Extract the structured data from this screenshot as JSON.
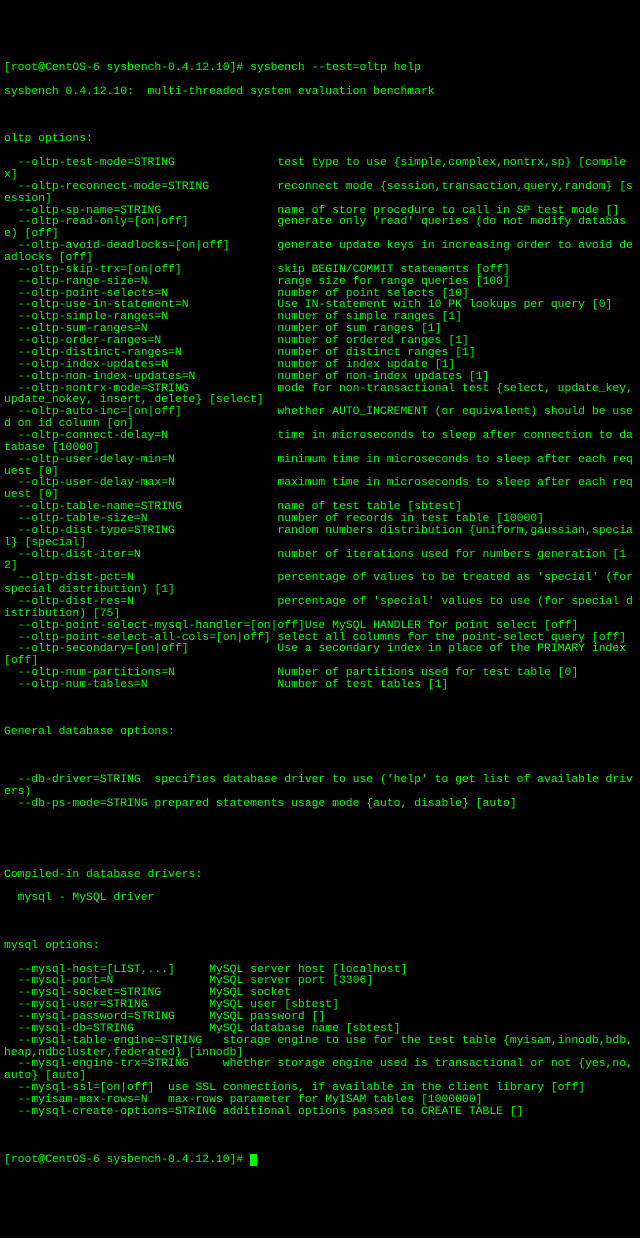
{
  "prompt": "[root@CentOS-6 sysbench-0.4.12.10]# ",
  "cmd": "sysbench --test=oltp help",
  "header": "sysbench 0.4.12.10:  multi-threaded system evaluation benchmark",
  "oltp_title": "oltp options:",
  "oltp_opts": [
    {
      "f": "  --oltp-test-mode=STRING",
      "d": "test type to use {simple,complex,nontrx,sp} [complex]"
    },
    {
      "f": "  --oltp-reconnect-mode=STRING",
      "d": "reconnect mode {session,transaction,query,random} [session]"
    },
    {
      "f": "  --oltp-sp-name=STRING",
      "d": "name of store procedure to call in SP test mode []"
    },
    {
      "f": "  --oltp-read-only=[on|off]",
      "d": "generate only 'read' queries (do not modify database) [off]"
    },
    {
      "f": "  --oltp-avoid-deadlocks=[on|off]",
      "d": "generate update keys in increasing order to avoid deadlocks [off]"
    },
    {
      "f": "  --oltp-skip-trx=[on|off]",
      "d": "skip BEGIN/COMMIT statements [off]"
    },
    {
      "f": "  --oltp-range-size=N",
      "d": "range size for range queries [100]"
    },
    {
      "f": "  --oltp-point-selects=N",
      "d": "number of point selects [10]"
    },
    {
      "f": "  --oltp-use-in-statement=N",
      "d": "Use IN-statement with 10 PK lookups per query [0]"
    },
    {
      "f": "  --oltp-simple-ranges=N",
      "d": "number of simple ranges [1]"
    },
    {
      "f": "  --oltp-sum-ranges=N",
      "d": "number of sum ranges [1]"
    },
    {
      "f": "  --oltp-order-ranges=N",
      "d": "number of ordered ranges [1]"
    },
    {
      "f": "  --oltp-distinct-ranges=N",
      "d": "number of distinct ranges [1]"
    },
    {
      "f": "  --oltp-index-updates=N",
      "d": "number of index update [1]"
    },
    {
      "f": "  --oltp-non-index-updates=N",
      "d": "number of non-index updates [1]"
    },
    {
      "f": "  --oltp-nontrx-mode=STRING",
      "d": "mode for non-transactional test {select, update_key, update_nokey, insert, delete} [select]"
    },
    {
      "f": "  --oltp-auto-inc=[on|off]",
      "d": "whether AUTO_INCREMENT (or equivalent) should be used on id column [on]"
    },
    {
      "f": "  --oltp-connect-delay=N",
      "d": "time in microseconds to sleep after connection to database [10000]"
    },
    {
      "f": "  --oltp-user-delay-min=N",
      "d": "minimum time in microseconds to sleep after each request [0]"
    },
    {
      "f": "  --oltp-user-delay-max=N",
      "d": "maximum time in microseconds to sleep after each request [0]"
    },
    {
      "f": "  --oltp-table-name=STRING",
      "d": "name of test table [sbtest]"
    },
    {
      "f": "  --oltp-table-size=N",
      "d": "number of records in test table [10000]"
    },
    {
      "f": "  --oltp-dist-type=STRING",
      "d": "random numbers distribution {uniform,gaussian,special} [special]"
    },
    {
      "f": "  --oltp-dist-iter=N",
      "d": "number of iterations used for numbers generation [12]"
    },
    {
      "f": "  --oltp-dist-pct=N",
      "d": "percentage of values to be treated as 'special' (for special distribution) [1]"
    },
    {
      "f": "  --oltp-dist-res=N",
      "d": "percentage of 'special' values to use (for special distribution) [75]"
    },
    {
      "f": "  --oltp-point-select-mysql-handler=[on|off]",
      "d": "Use MySQL HANDLER for point select [off]"
    },
    {
      "f": "  --oltp-point-select-all-cols=[on|off]",
      "d": "select all columns for the point-select query [off]"
    },
    {
      "f": "  --oltp-secondary=[on|off]",
      "d": "Use a secondary index in place of the PRIMARY index [off]"
    },
    {
      "f": "  --oltp-num-partitions=N",
      "d": "Number of partitions used for test table [0]"
    },
    {
      "f": "  --oltp-num-tables=N",
      "d": "Number of test tables [1]"
    }
  ],
  "general_title": "General database options:",
  "general_lines": [
    "  --db-driver=STRING  specifies database driver to use ('help' to get list of available drivers)",
    "  --db-ps-mode=STRING prepared statements usage mode {auto, disable} [auto]"
  ],
  "compiled_title": "Compiled-in database drivers:",
  "compiled_line": "  mysql - MySQL driver",
  "mysql_title": "mysql options:",
  "mysql_opts": [
    {
      "f": "  --mysql-host=[LIST,...]",
      "d": "MySQL server host [localhost]"
    },
    {
      "f": "  --mysql-port=N",
      "d": "MySQL server port [3306]"
    },
    {
      "f": "  --mysql-socket=STRING",
      "d": "MySQL socket"
    },
    {
      "f": "  --mysql-user=STRING",
      "d": "MySQL user [sbtest]"
    },
    {
      "f": "  --mysql-password=STRING",
      "d": "MySQL password []"
    },
    {
      "f": "  --mysql-db=STRING",
      "d": "MySQL database name [sbtest]"
    },
    {
      "f": "  --mysql-table-engine=STRING",
      "d": "storage engine to use for the test table {myisam,innodb,bdb,heap,ndbcluster,federated} [innodb]"
    },
    {
      "f": "  --mysql-engine-trx=STRING",
      "d": "whether storage engine used is transactional or not {yes,no,auto} [auto]"
    },
    {
      "f": "  --mysql-ssl=[on|off]",
      "d": "use SSL connections, if available in the client library [off]"
    },
    {
      "f": "  --myisam-max-rows=N",
      "d": "max-rows parameter for MyISAM tables [1000000]"
    },
    {
      "f": "  --mysql-create-options=STRING",
      "d": "additional options passed to CREATE TABLE []"
    }
  ],
  "oltp_col": 40,
  "mysql_col": 30,
  "mysql_col_long": 32,
  "mysql_col_short": 24
}
